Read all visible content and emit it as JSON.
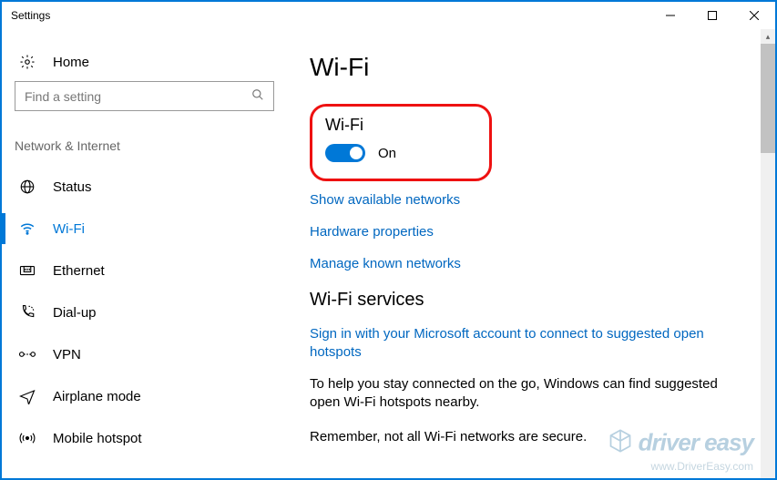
{
  "window": {
    "title": "Settings"
  },
  "sidebar": {
    "home_label": "Home",
    "search_placeholder": "Find a setting",
    "section_label": "Network & Internet",
    "items": [
      {
        "label": "Status"
      },
      {
        "label": "Wi-Fi"
      },
      {
        "label": "Ethernet"
      },
      {
        "label": "Dial-up"
      },
      {
        "label": "VPN"
      },
      {
        "label": "Airplane mode"
      },
      {
        "label": "Mobile hotspot"
      }
    ]
  },
  "main": {
    "page_title": "Wi-Fi",
    "wifi_heading": "Wi-Fi",
    "toggle_state_label": "On",
    "link_show_networks": "Show available networks",
    "link_hardware_props": "Hardware properties",
    "link_manage_networks": "Manage known networks",
    "services_heading": "Wi-Fi services",
    "link_signin": "Sign in with your Microsoft account to connect to suggested open hotspots",
    "services_body1": "To help you stay connected on the go, Windows can find suggested open Wi-Fi hotspots nearby.",
    "services_body2": "Remember, not all Wi-Fi networks are secure."
  },
  "watermark": {
    "brand": "driver easy",
    "url": "www.DriverEasy.com"
  },
  "colors": {
    "accent": "#0078d7",
    "link": "#0067c0",
    "highlight": "#e11"
  }
}
